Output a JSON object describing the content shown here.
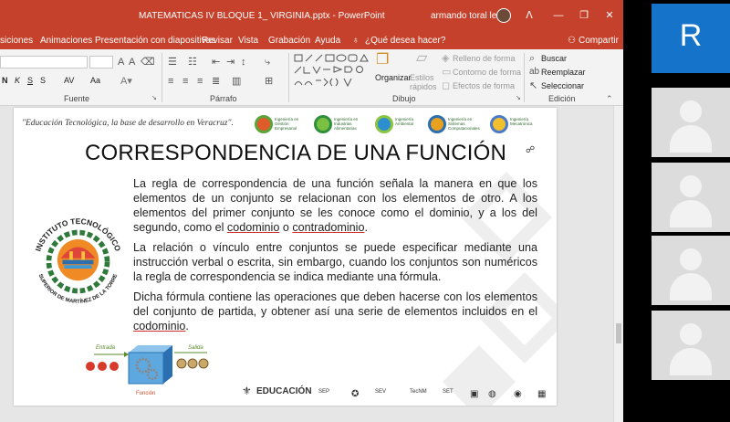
{
  "window": {
    "title": "MATEMATICAS IV BLOQUE 1_ VIRGINIA.pptx  -  PowerPoint",
    "user": "armando toral leon",
    "controls": [
      "ᐱ",
      "—",
      "❐",
      "✕"
    ]
  },
  "tabs": [
    "siciones",
    "Animaciones",
    "Presentación con diapositivas",
    "Revisar",
    "Vista",
    "Grabación",
    "Ayuda",
    "¿Qué desea hacer?",
    "Compartir"
  ],
  "ribbon": {
    "groups": {
      "fuente": "Fuente",
      "parrafo": "Párrafo",
      "dibujo": "Dibujo",
      "edicion": "Edición"
    },
    "organizar": "Organizar",
    "estilos": "Estilos rápidos",
    "relleno": "Relleno de forma",
    "contorno": "Contorno de forma",
    "efectos": "Efectos de forma",
    "buscar": "Buscar",
    "reemplazar": "Reemplazar",
    "seleccionar": "Seleccionar",
    "font_buttons": [
      "N",
      "K",
      "S",
      "S",
      "AV",
      "Aa"
    ]
  },
  "slide": {
    "slogan": "\"Educación Tecnológica, la base de desarrollo en Veracruz\".",
    "top_logos": [
      {
        "caption": "Ingeniería en\nGestión\nEmpresarial",
        "color": "#e05a2a"
      },
      {
        "caption": "Ingeniería en\nIndustrias\nAlimentarias",
        "color": "#2f8f3a"
      },
      {
        "caption": "Ingeniería\nAmbiental",
        "color": "#2b8fd0"
      },
      {
        "caption": "Ingeniería en\nSistemas\nComputacionales",
        "color": "#e8a020"
      },
      {
        "caption": "Ingeniería\nMecatrónica",
        "color": "#4a7ac8"
      }
    ],
    "title": "CORRESPONDENCIA DE UNA FUNCIÓN",
    "p1_a": "La regla de correspondencia de una función señala la manera en que los elementos de un conjunto se relacionan con los elementos de otro. A los elementos del primer conjunto se les conoce como el dominio, y a los del segundo, como el ",
    "p1_codominio": "codominio",
    "p1_o": " o ",
    "p1_contradominio": "contradominio",
    "p1_end": ".",
    "p2": "La relación o vínculo entre conjuntos se puede especificar mediante una instrucción verbal o escrita, sin embargo, cuando los conjuntos son numéricos la regla de correspondencia se indica mediante una fórmula.",
    "p3_a": "Dicha fórmula contiene las operaciones que deben hacerse con los elementos del conjunto de partida, y obtener así una serie de elementos incluidos en el ",
    "p3_codominio": "codominio",
    "p3_end": ".",
    "seal_top": "INSTITUTO TECNOLÓGICO",
    "seal_bottom": "SUPERIOR DE MARTÍNEZ DE LA TORRE",
    "diagram": {
      "entrada": "Entrada",
      "salida": "Salida",
      "funcion": "Función"
    },
    "footer": [
      "EDUCACIÓN",
      "SEP",
      "SEV",
      "TecNM",
      "SET"
    ]
  },
  "participants": {
    "active_initial": "R",
    "others_count": 4
  }
}
